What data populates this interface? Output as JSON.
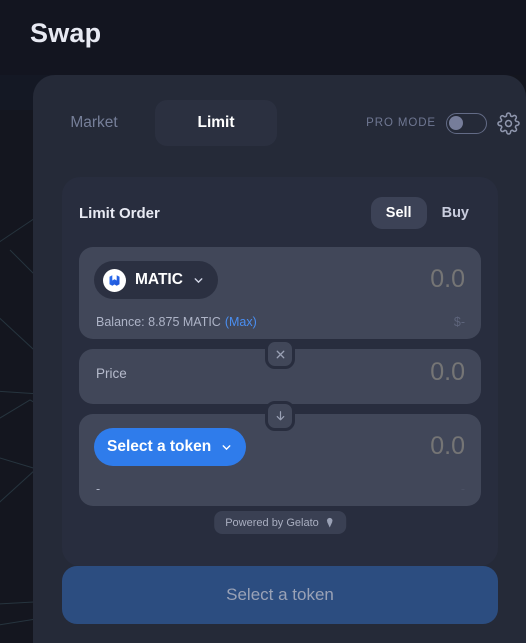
{
  "header": {
    "title": "Swap"
  },
  "tabs": [
    {
      "label": "Market",
      "active": false
    },
    {
      "label": "Limit",
      "active": true
    }
  ],
  "pro_mode": {
    "label": "PRO MODE",
    "enabled": false
  },
  "settings": {
    "icon": "gear-icon"
  },
  "card": {
    "title": "Limit Order",
    "side_buttons": [
      {
        "label": "Sell",
        "active": true
      },
      {
        "label": "Buy",
        "active": false
      }
    ],
    "from": {
      "token": "MATIC",
      "token_logo": "matic-logo",
      "amount_placeholder": "0.0",
      "amount_value": "",
      "balance_text": "Balance: 8.875 MATIC",
      "max_label": "(Max)",
      "usd_value": "$-"
    },
    "price": {
      "label": "Price",
      "amount_placeholder": "0.0",
      "amount_value": ""
    },
    "to": {
      "token": "Select a token",
      "amount_placeholder": "0.0",
      "amount_value": "",
      "left_dash": "-",
      "right_dash": "-"
    },
    "clear_button": "close-icon",
    "switch_button": "arrow-down-icon"
  },
  "footer": {
    "powered_by": "Powered by Gelato",
    "action_button": "Select a token"
  },
  "colors": {
    "page_bg": "#14161f",
    "header_bg": "#131520",
    "panel_bg": "#252a38",
    "card_bg": "#282d3e",
    "row_bg": "#414759",
    "accent_blue": "#2f7ceb",
    "link_blue": "#4a8ef0",
    "action_btn": "#2c4d80"
  }
}
